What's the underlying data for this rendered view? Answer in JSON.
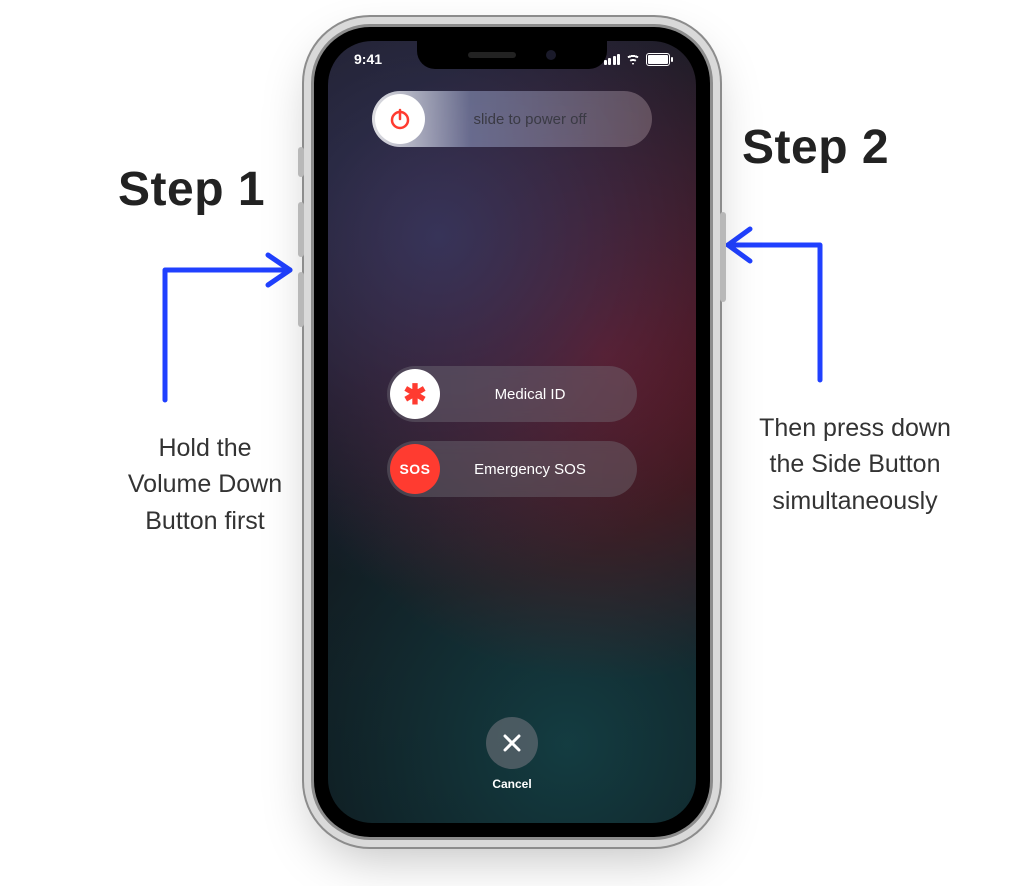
{
  "annotations": {
    "step1": {
      "title": "Step 1",
      "caption": "Hold the\nVolume Down\nButton first"
    },
    "step2": {
      "title": "Step 2",
      "caption": "Then press down\nthe Side Button\nsimultaneously"
    }
  },
  "statusbar": {
    "time": "9:41"
  },
  "sliders": {
    "power": {
      "label": "slide to power off",
      "icon": "power-icon"
    },
    "medical": {
      "label": "Medical ID",
      "icon": "asterisk-icon"
    },
    "sos": {
      "label": "Emergency SOS",
      "icon": "sos-icon",
      "icon_text": "SOS"
    }
  },
  "cancel": {
    "label": "Cancel",
    "icon": "close-icon"
  }
}
